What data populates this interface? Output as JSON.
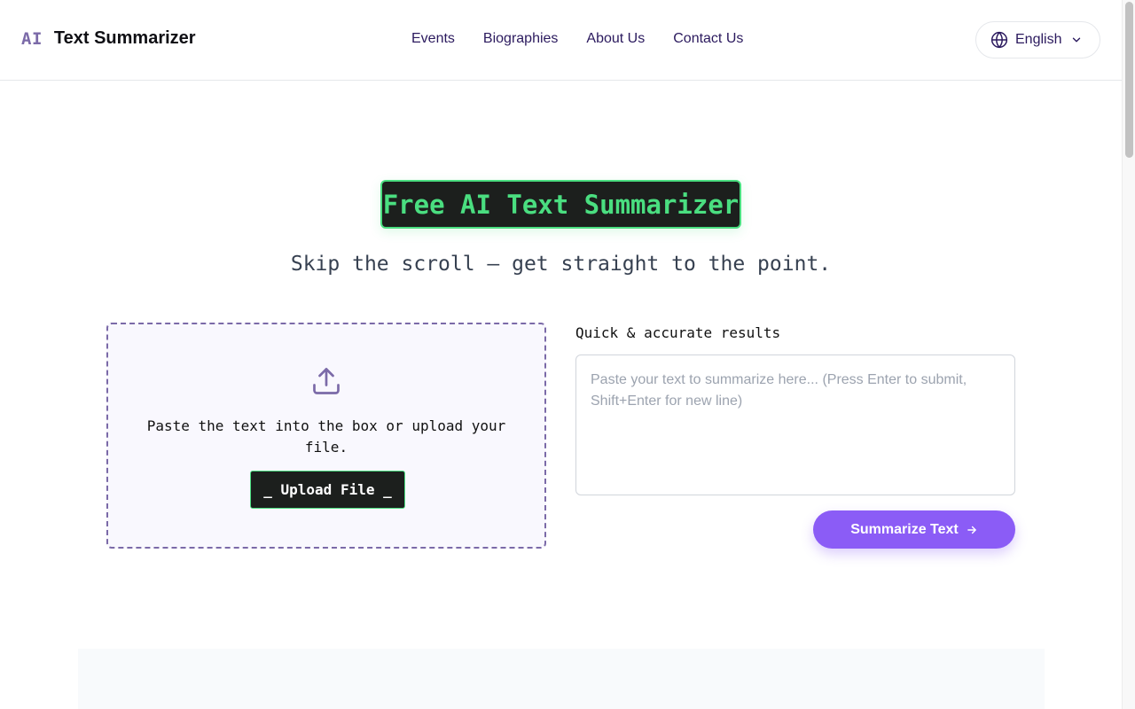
{
  "header": {
    "brand_prefix": "AI",
    "brand_name": "Text Summarizer",
    "nav": [
      {
        "label": "Events"
      },
      {
        "label": "Biographies"
      },
      {
        "label": "About Us"
      },
      {
        "label": "Contact Us"
      }
    ],
    "language": {
      "label": "English",
      "icon": "globe-icon"
    }
  },
  "hero": {
    "title": "Free AI Text Summarizer",
    "subtitle": "Skip the scroll — get straight to the point."
  },
  "upload": {
    "icon": "upload-icon",
    "instruction": "Paste the text into the box or upload your file.",
    "button_label": "_ Upload File _"
  },
  "summarize": {
    "label": "Quick & accurate results",
    "placeholder": "Paste your text to summarize here... (Press Enter to submit, Shift+Enter for new line)",
    "value": "",
    "button_label": "Summarize Text",
    "button_icon": "arrow-right-icon"
  },
  "colors": {
    "accent_purple": "#8b5cf6",
    "brand_purple": "#7b6aa8",
    "nav_text": "#2b1a5e",
    "terminal_green": "#4ade80",
    "terminal_bg": "#1c1f1d"
  }
}
